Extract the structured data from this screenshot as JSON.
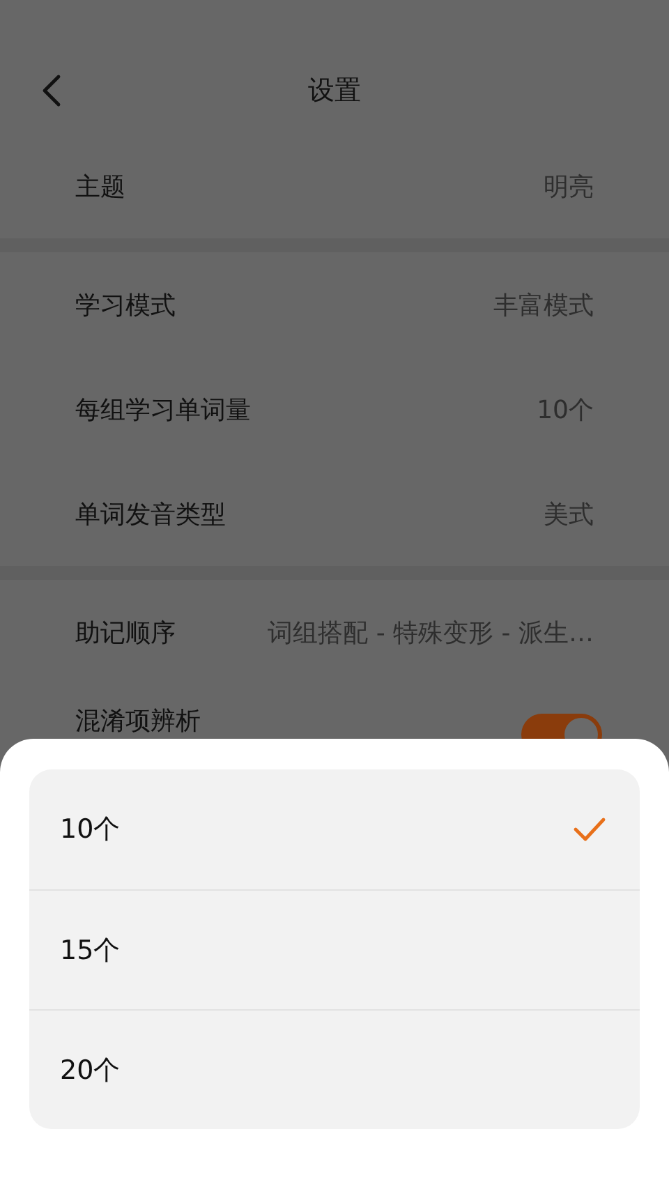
{
  "header": {
    "title": "设置"
  },
  "sections": [
    {
      "rows": [
        {
          "kind": "value",
          "label": "主题",
          "value": "明亮"
        }
      ]
    },
    {
      "rows": [
        {
          "kind": "value",
          "label": "学习模式",
          "value": "丰富模式"
        },
        {
          "kind": "value",
          "label": "每组学习单词量",
          "value": "10个"
        },
        {
          "kind": "value",
          "label": "单词发音类型",
          "value": "美式"
        }
      ]
    },
    {
      "rows": [
        {
          "kind": "value",
          "label": "助记顺序",
          "value": "词组搭配 - 特殊变形 - 派生…"
        },
        {
          "kind": "toggle",
          "label": "混淆项辨析",
          "on": true
        }
      ]
    }
  ],
  "sheet": {
    "options": [
      {
        "label": "10个",
        "selected": true
      },
      {
        "label": "15个",
        "selected": false
      },
      {
        "label": "20个",
        "selected": false
      }
    ]
  }
}
